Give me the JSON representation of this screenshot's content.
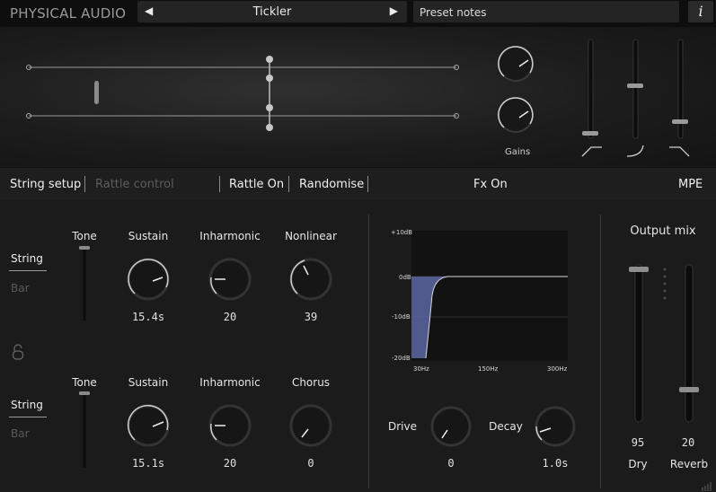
{
  "header": {
    "brand": "PHYSICAL AUDIO",
    "preset_name": "Tickler",
    "prev_arrow": "◀",
    "next_arrow": "▶",
    "preset_notes": "Preset notes",
    "info_label": "i"
  },
  "strings_view": {
    "gains_label": "Gains",
    "gain_knob_1": 0.6,
    "gain_knob_2": 0.6
  },
  "tabs": {
    "string_setup": "String setup",
    "rattle_control": "Rattle control",
    "rattle_on": "Rattle On",
    "randomise": "Randomise",
    "fx_on": "Fx On",
    "mpe": "MPE"
  },
  "voice1": {
    "string_label": "String",
    "bar_label": "Bar",
    "tone_label": "Tone",
    "sustain_label": "Sustain",
    "sustain_value": "15.4s",
    "inharmonic_label": "Inharmonic",
    "inharmonic_value": "20",
    "nonlinear_label": "Nonlinear",
    "nonlinear_value": "39"
  },
  "voice2": {
    "string_label": "String",
    "bar_label": "Bar",
    "tone_label": "Tone",
    "sustain_label": "Sustain",
    "sustain_value": "15.1s",
    "inharmonic_label": "Inharmonic",
    "inharmonic_value": "20",
    "chorus_label": "Chorus",
    "chorus_value": "0"
  },
  "eq": {
    "y_labels": [
      "+10dB",
      "0dB",
      "-10dB",
      "-20dB"
    ],
    "x_labels": [
      "30Hz",
      "150Hz",
      "300Hz"
    ]
  },
  "fx": {
    "drive_label": "Drive",
    "drive_value": "0",
    "decay_label": "Decay",
    "decay_value": "1.0s"
  },
  "output": {
    "title": "Output mix",
    "dry_label": "Dry",
    "dry_value": "95",
    "reverb_label": "Reverb",
    "reverb_value": "20"
  },
  "colors": {
    "accent_fill": "#5d6aa0",
    "background": "#1b1b1b"
  }
}
